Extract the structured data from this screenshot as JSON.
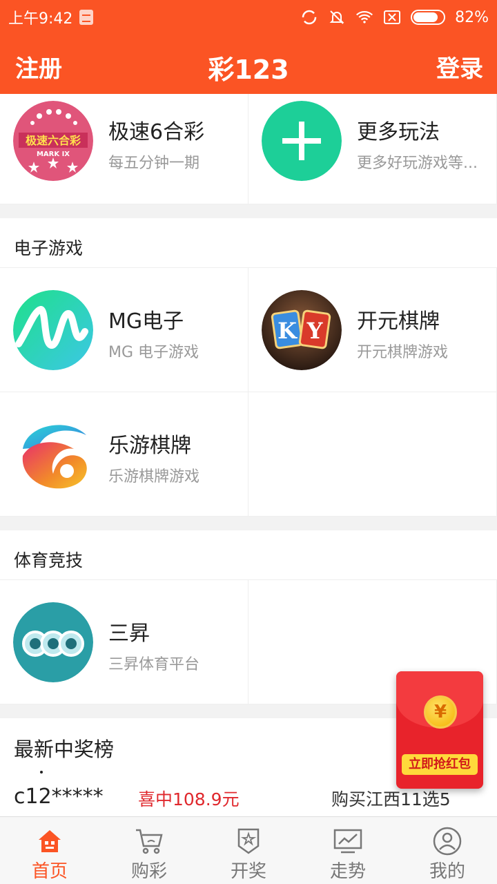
{
  "statusbar": {
    "time": "上午9:42",
    "battery": "82%",
    "battery_level": 0.82
  },
  "header": {
    "left": "注册",
    "title": "彩123",
    "right": "登录"
  },
  "top_games": [
    {
      "name": "极速6合彩",
      "desc": "每五分钟一期",
      "icon": "mark-six-logo"
    },
    {
      "name": "更多玩法",
      "desc": "更多好玩游戏等...",
      "icon": "plus-icon"
    }
  ],
  "electronic": {
    "title": "电子游戏",
    "items": [
      {
        "name": "MG电子",
        "desc": "MG 电子游戏",
        "icon": "mg-logo"
      },
      {
        "name": "开元棋牌",
        "desc": "开元棋牌游戏",
        "icon": "ky-logo",
        "logo_text": "KY"
      },
      {
        "name": "乐游棋牌",
        "desc": "乐游棋牌游戏",
        "icon": "leyou-logo"
      }
    ]
  },
  "sports": {
    "title": "体育竞技",
    "items": [
      {
        "name": "三昇",
        "desc": "三昇体育平台",
        "icon": "sansheng-logo"
      }
    ]
  },
  "winners": {
    "title": "最新中奖榜",
    "rows": [
      {
        "user": "c12*****",
        "win": "喜中108.9元",
        "bought": "购买江西11选5"
      }
    ]
  },
  "redpacket": {
    "symbol": "¥",
    "label": "立即抢红包"
  },
  "tabs": [
    {
      "label": "首页",
      "icon": "home-icon",
      "active": true
    },
    {
      "label": "购彩",
      "icon": "cart-icon",
      "active": false
    },
    {
      "label": "开奖",
      "icon": "award-icon",
      "active": false
    },
    {
      "label": "走势",
      "icon": "trend-icon",
      "active": false
    },
    {
      "label": "我的",
      "icon": "profile-icon",
      "active": false
    }
  ],
  "colors": {
    "primary": "#fb5424",
    "win_red": "#e0282d",
    "plus_green": "#1dcf98"
  }
}
